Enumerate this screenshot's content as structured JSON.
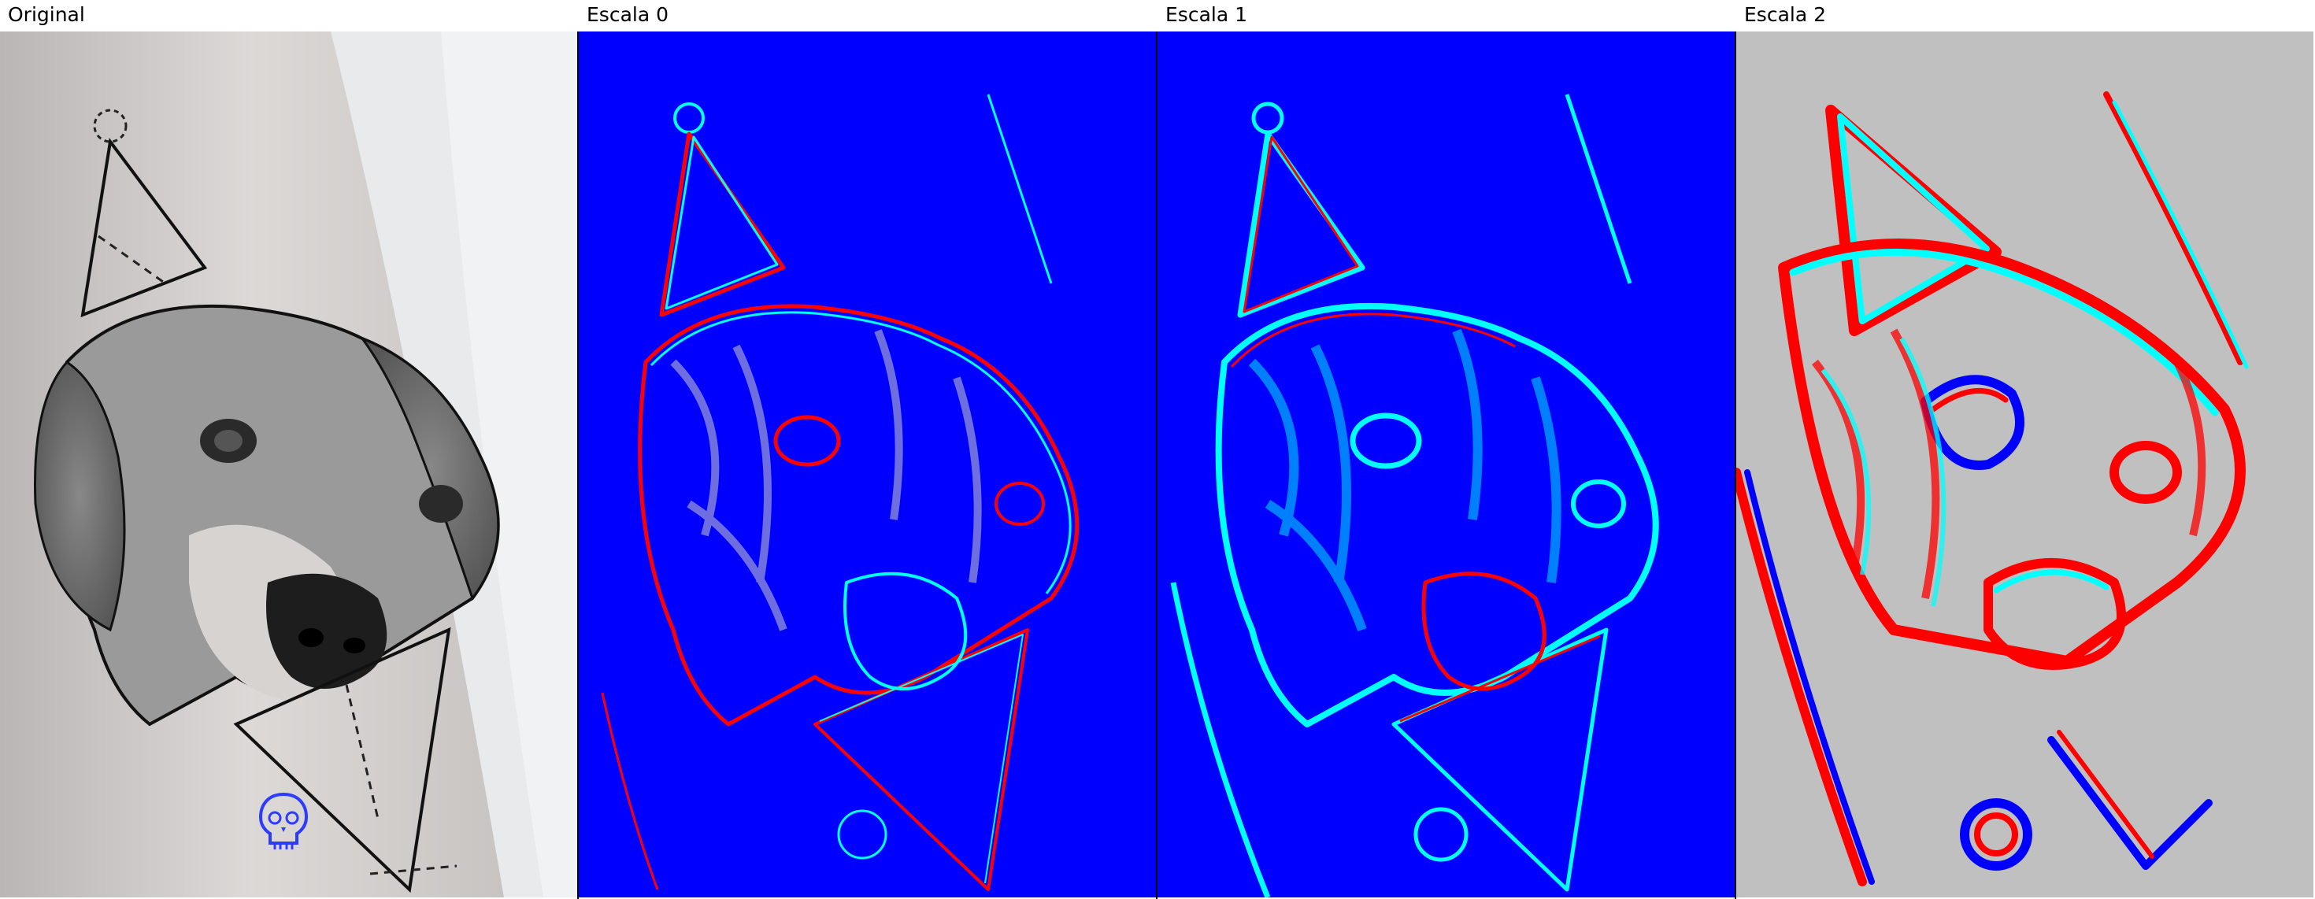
{
  "panels": [
    {
      "title": "Original"
    },
    {
      "title": "Escala 0"
    },
    {
      "title": "Escala 1"
    },
    {
      "title": "Escala 2"
    }
  ],
  "colors": {
    "background_blue": "#0000ff",
    "background_gray": "#c0c0c0",
    "edge_red": "#ff0000",
    "edge_cyan": "#00ffff",
    "edge_blue": "#0000ff",
    "skin": "#d9d6d4"
  },
  "icons": [
    "skull-icon"
  ]
}
